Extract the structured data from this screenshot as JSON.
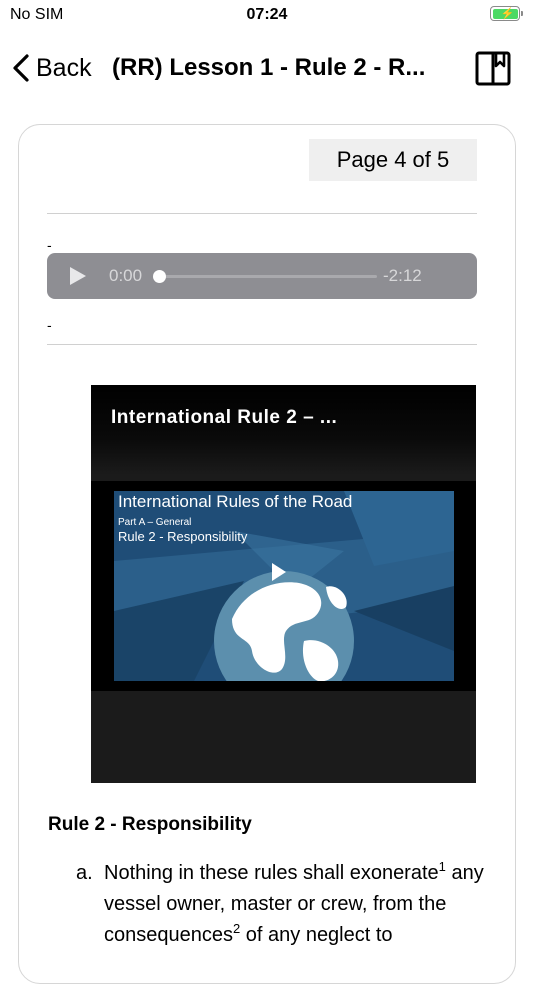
{
  "status_bar": {
    "carrier": "No SIM",
    "time": "07:24",
    "battery_color": "#4cd964"
  },
  "nav": {
    "back_label": "Back",
    "title": "(RR) Lesson 1 - Rule 2 - R...",
    "back_icon": "chevron-left-icon",
    "bookmark_icon": "book-bookmark-icon"
  },
  "page_indicator": "Page 4 of 5",
  "separators": {
    "dash_top": "-",
    "dash_bottom": "-"
  },
  "audio": {
    "elapsed": "0:00",
    "remaining": "-2:12",
    "progress": 0
  },
  "video": {
    "title": "International Rule 2 – ...",
    "slide_heading": "International Rules of the Road",
    "slide_part": "Part A – General",
    "slide_rule": "Rule 2 - Responsibility"
  },
  "content": {
    "heading": "Rule 2 - Responsibility",
    "item_marker": "a.",
    "item_text_1": "Nothing in these rules shall exonerate",
    "sup_1": "1",
    "item_text_2": " any vessel owner, master or crew, from the consequences",
    "sup_2": "2",
    "item_text_3": " of any neglect to"
  }
}
